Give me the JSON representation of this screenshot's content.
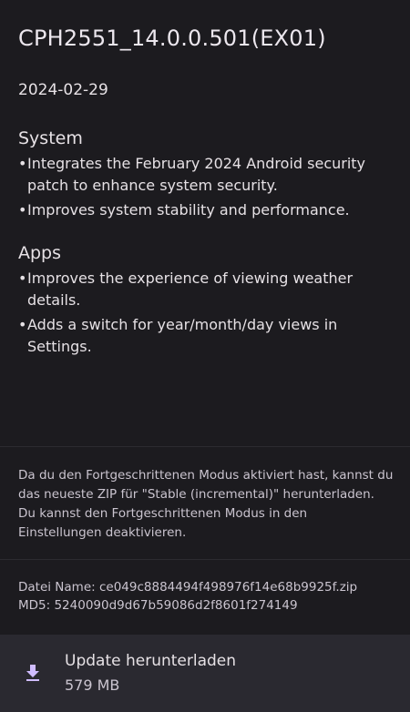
{
  "update": {
    "title": "CPH2551_14.0.0.501(EX01)",
    "date": "2024-02-29"
  },
  "sections": [
    {
      "heading": "System",
      "bullets": [
        "Integrates the February 2024 Android security patch to enhance system security.",
        "Improves system stability and performance."
      ]
    },
    {
      "heading": "Apps",
      "bullets": [
        "Improves the experience of viewing weather details.",
        "Adds a switch for year/month/day views in Settings."
      ]
    }
  ],
  "bullet_symbol": "•",
  "notice": "Da du den Fortgeschrittenen Modus aktiviert hast, kannst du das neueste ZIP für \"Stable (incremental)\" herunterladen. Du kannst den Fortgeschrittenen Modus in den Einstellungen deaktivieren.",
  "file": {
    "name_line": "Datei Name: ce049c8884494f498976f14e68b9925f.zip",
    "md5_line": "MD5: 5240090d9d67b59086d2f8601f274149"
  },
  "download": {
    "label": "Update herunterladen",
    "size": "579 MB",
    "icon": "download-icon"
  },
  "colors": {
    "background": "#1c1b1f",
    "download_bar": "#2a2930",
    "icon_accent": "#d0bcff",
    "text_primary": "#e6e1e5",
    "text_secondary": "#cac4cf"
  }
}
